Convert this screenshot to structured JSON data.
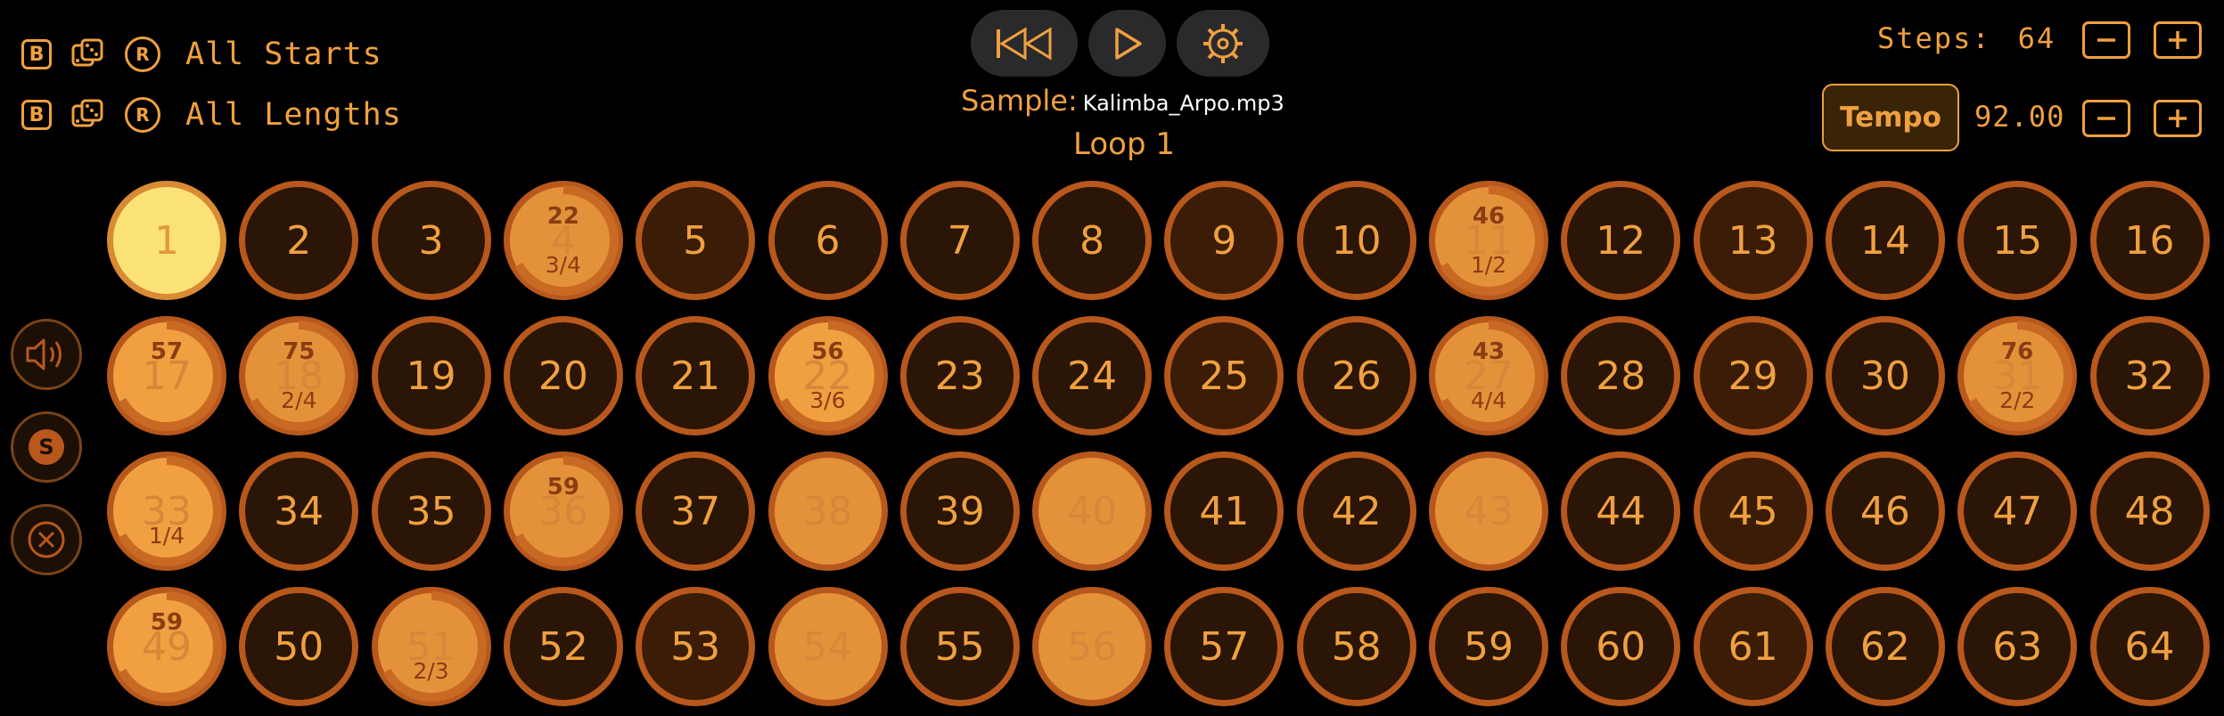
{
  "top_left": {
    "row1": {
      "b_label": "B",
      "r_label": "R",
      "label": "All Starts"
    },
    "row2": {
      "b_label": "B",
      "r_label": "R",
      "label": "All Lengths"
    }
  },
  "transport": {
    "rewind_icon": "rewind-to-start-icon",
    "play_icon": "play-icon",
    "settings_icon": "gear-icon"
  },
  "sample": {
    "label": "Sample:",
    "filename": "Kalimba_Arpo.mp3"
  },
  "loop": {
    "label": "Loop 1"
  },
  "steps": {
    "label": "Steps:",
    "value": "64"
  },
  "tempo": {
    "label": "Tempo",
    "value": "92.00"
  },
  "side": {
    "volume_icon": "speaker-icon",
    "solo_label": "S",
    "clear_icon": "close-circle-icon"
  },
  "colors": {
    "accent": "#f0a040",
    "ring": "#b8581c",
    "cell_dark": "#2a1506",
    "cell_lit": "#e4923a",
    "cell_first": "#fae277"
  },
  "cells": [
    {
      "n": "1",
      "state": "first"
    },
    {
      "n": "2"
    },
    {
      "n": "3"
    },
    {
      "n": "4",
      "state": "lit",
      "top": "22",
      "bottom": "3/4"
    },
    {
      "n": "5",
      "state": "dark2"
    },
    {
      "n": "6"
    },
    {
      "n": "7"
    },
    {
      "n": "8"
    },
    {
      "n": "9",
      "state": "dark2"
    },
    {
      "n": "10"
    },
    {
      "n": "11",
      "state": "lit",
      "top": "46",
      "bottom": "1/2"
    },
    {
      "n": "12"
    },
    {
      "n": "13",
      "state": "dark2"
    },
    {
      "n": "14"
    },
    {
      "n": "15"
    },
    {
      "n": "16"
    },
    {
      "n": "17",
      "state": "lit2",
      "top": "57"
    },
    {
      "n": "18",
      "state": "lit",
      "top": "75",
      "bottom": "2/4"
    },
    {
      "n": "19"
    },
    {
      "n": "20"
    },
    {
      "n": "21"
    },
    {
      "n": "22",
      "state": "lit2",
      "top": "56",
      "bottom": "3/6"
    },
    {
      "n": "23"
    },
    {
      "n": "24"
    },
    {
      "n": "25",
      "state": "dark2"
    },
    {
      "n": "26"
    },
    {
      "n": "27",
      "state": "lit",
      "top": "43",
      "bottom": "4/4"
    },
    {
      "n": "28"
    },
    {
      "n": "29",
      "state": "dark2"
    },
    {
      "n": "30"
    },
    {
      "n": "31",
      "state": "lit",
      "top": "76",
      "bottom": "2/2"
    },
    {
      "n": "32"
    },
    {
      "n": "33",
      "state": "lit2",
      "bottom": "1/4"
    },
    {
      "n": "34"
    },
    {
      "n": "35"
    },
    {
      "n": "36",
      "state": "lit",
      "top": "59"
    },
    {
      "n": "37"
    },
    {
      "n": "38",
      "state": "lit"
    },
    {
      "n": "39"
    },
    {
      "n": "40",
      "state": "lit"
    },
    {
      "n": "41"
    },
    {
      "n": "42"
    },
    {
      "n": "43",
      "state": "lit"
    },
    {
      "n": "44"
    },
    {
      "n": "45",
      "state": "dark2"
    },
    {
      "n": "46"
    },
    {
      "n": "47"
    },
    {
      "n": "48"
    },
    {
      "n": "49",
      "state": "lit2",
      "top": "59"
    },
    {
      "n": "50"
    },
    {
      "n": "51",
      "state": "lit",
      "bottom": "2/3"
    },
    {
      "n": "52"
    },
    {
      "n": "53",
      "state": "dark2"
    },
    {
      "n": "54",
      "state": "lit"
    },
    {
      "n": "55"
    },
    {
      "n": "56",
      "state": "lit"
    },
    {
      "n": "57"
    },
    {
      "n": "58"
    },
    {
      "n": "59"
    },
    {
      "n": "60"
    },
    {
      "n": "61",
      "state": "dark2"
    },
    {
      "n": "62"
    },
    {
      "n": "63"
    },
    {
      "n": "64"
    }
  ]
}
